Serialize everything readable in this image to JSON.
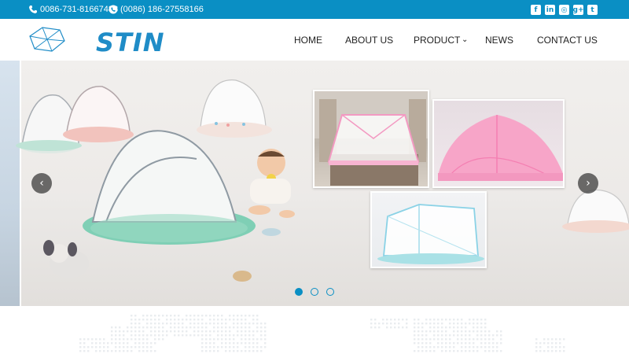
{
  "topbar": {
    "phone": "0086-731-81667488",
    "whatsapp": "(0086) 186-27558166",
    "social": [
      "f",
      "in",
      "◎",
      "g+",
      "t"
    ]
  },
  "logo": {
    "text": "STIN"
  },
  "nav": {
    "home": "HOME",
    "about": "ABOUT US",
    "product": "PRODUCT",
    "product_caret": "⌄",
    "news": "NEWS",
    "contact": "CONTACT US"
  },
  "banner": {
    "prev": "‹",
    "next": "›",
    "slides": 3,
    "active_slide": 1
  },
  "colors": {
    "brand": "#0a8fc4",
    "logo": "#1f8cc7"
  }
}
